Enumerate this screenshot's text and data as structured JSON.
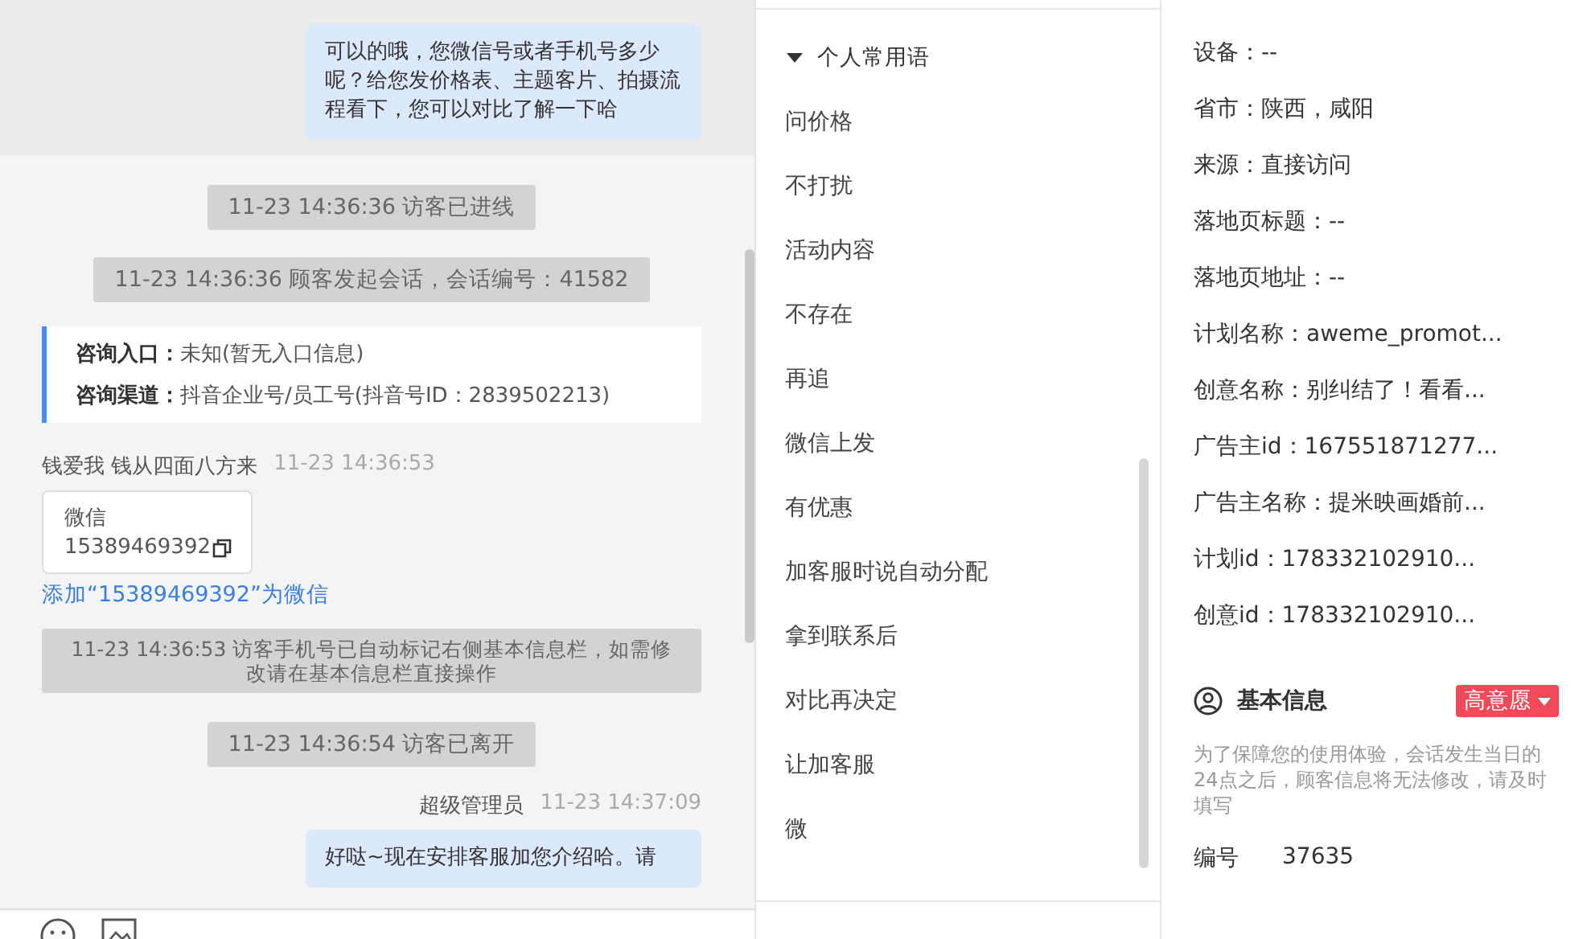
{
  "chat": {
    "messages": [
      {
        "kind": "agent_bubble",
        "text": "可以的哦，您微信号或者手机号多少呢？给您发价格表、主题客片、拍摄流程看下，您可以对比了解一下哈"
      },
      {
        "kind": "system",
        "text": "11-23 14:36:36 访客已进线"
      },
      {
        "kind": "system",
        "text": "11-23 14:36:36 顾客发起会话，会话编号：41582"
      },
      {
        "kind": "source",
        "rows": [
          {
            "label": "咨询入口：",
            "value": "未知(暂无入口信息)"
          },
          {
            "label": "咨询渠道：",
            "value": "抖音企业号/员工号(抖音号ID：2839502213)"
          }
        ]
      },
      {
        "kind": "visitor_sender",
        "name": "钱爱我 钱从四面八方来",
        "time": "11-23 14:36:53"
      },
      {
        "kind": "contact_card",
        "title": "微信",
        "number": "15389469392"
      },
      {
        "kind": "link",
        "text": "添加“15389469392”为微信"
      },
      {
        "kind": "system_wide",
        "text": "11-23 14:36:53 访客手机号已自动标记右侧基本信息栏，如需修改请在基本信息栏直接操作"
      },
      {
        "kind": "system",
        "text": "11-23 14:36:54 访客已离开"
      },
      {
        "kind": "agent_sender",
        "name": "超级管理员",
        "time": "11-23 14:37:09"
      },
      {
        "kind": "agent_bubble",
        "text": "好哒~现在安排客服加您介绍哈。请"
      }
    ]
  },
  "phrases": {
    "group": {
      "label": "个人常用语",
      "expanded": true
    },
    "items": [
      "问价格",
      "不打扰",
      "活动内容",
      "不存在",
      "再追",
      "微信上发",
      "有优惠",
      "加客服时说自动分配",
      "拿到联系后",
      "对比再决定",
      "让加客服",
      "微"
    ]
  },
  "info": {
    "rows": [
      "设备：--",
      "省市：陕西，咸阳",
      "来源：直接访问",
      "落地页标题：--",
      "落地页地址：--",
      "计划名称：aweme_promot...",
      "创意名称：别纠结了！看看...",
      "广告主id：167551871277...",
      "广告主名称：提米映画婚前...",
      "计划id：178332102910...",
      "创意id：178332102910..."
    ],
    "basic": {
      "title": "基本信息",
      "intent": "高意愿",
      "note": "为了保障您的使用体验，会话发生当日的24点之后，顾客信息将无法修改，请及时填写",
      "fields": [
        {
          "label": "编号",
          "value": "37635"
        }
      ]
    }
  }
}
